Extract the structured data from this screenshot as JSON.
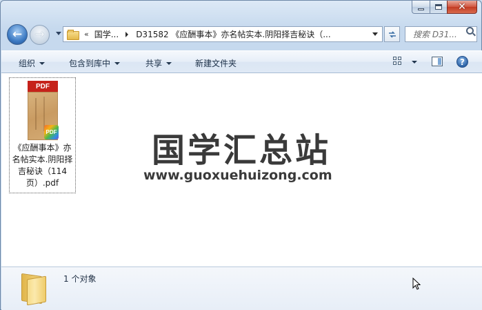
{
  "breadcrumb": {
    "overflow": "«",
    "root": "国学...",
    "current": "D31582 《应酬事本》亦名帖实本.阴阳择吉秘诀（..."
  },
  "search": {
    "placeholder": "搜索 D31..."
  },
  "toolbar": {
    "organize": "组织",
    "include_in_library": "包含到库中",
    "share": "共享",
    "new_folder": "新建文件夹",
    "help": "?"
  },
  "caption": {
    "close": "✕"
  },
  "nav": {
    "back": "←",
    "forward": "→"
  },
  "file": {
    "name": "《应酬事本》亦名帖实本.阴阳择吉秘诀（114页）.pdf",
    "thumb_header": "PDF",
    "badge": "PDF"
  },
  "watermark": {
    "title": "国学汇总站",
    "url": "www.guoxuehuizong.com"
  },
  "details": {
    "count": "1 个对象"
  },
  "colors": {
    "pdf_red": "#c6221a",
    "close_red": "#c23b23",
    "accent_blue": "#3d7bc4"
  }
}
